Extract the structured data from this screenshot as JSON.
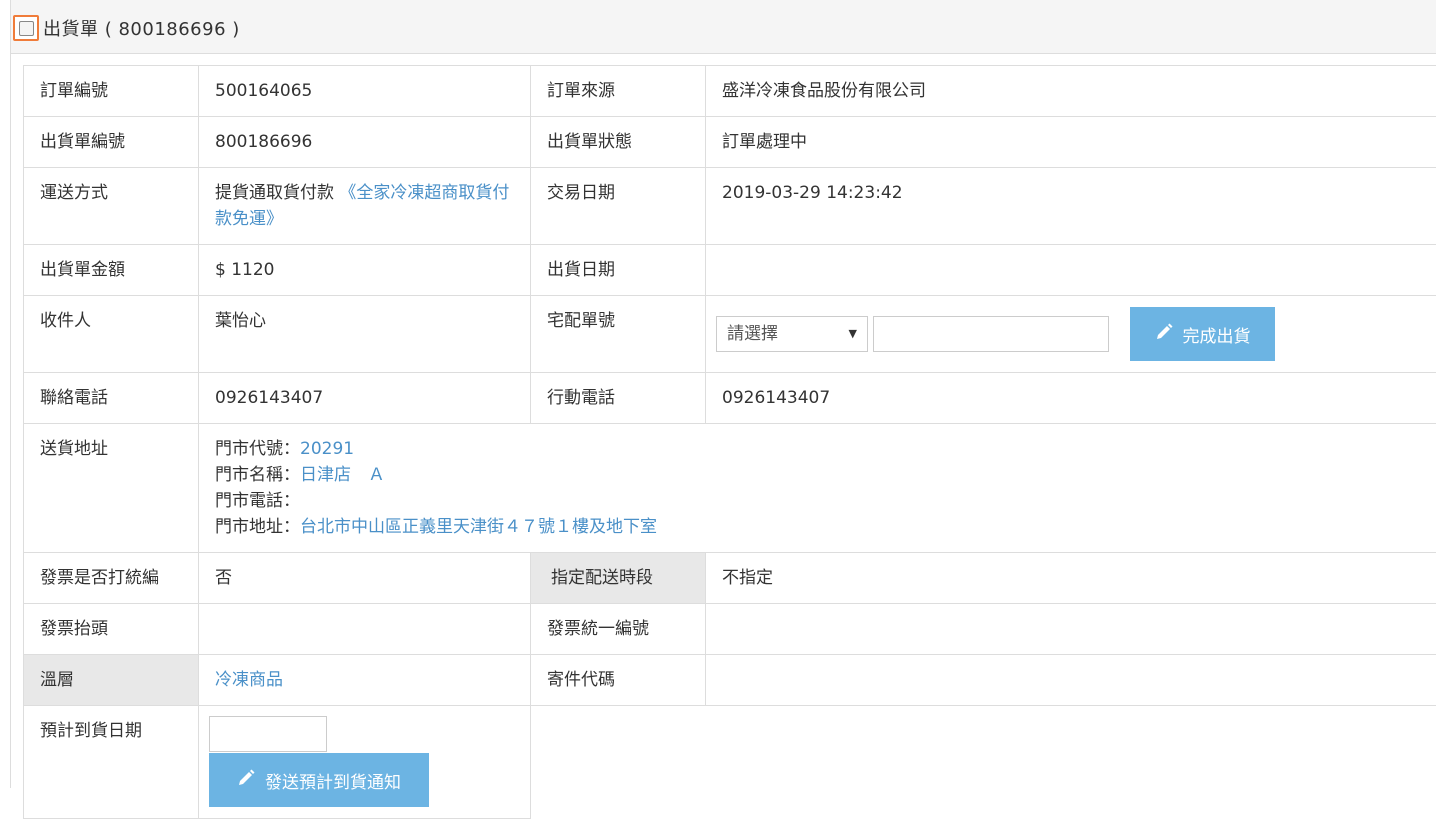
{
  "header": {
    "title": "出貨單 ( 800186696 )"
  },
  "rows": {
    "order_no_label": "訂單編號",
    "order_no": "500164065",
    "order_source_label": "訂單來源",
    "order_source": "盛洋冷凍食品股份有限公司",
    "ship_no_label": "出貨單編號",
    "ship_no": "800186696",
    "ship_status_label": "出貨單狀態",
    "ship_status": "訂單處理中",
    "delivery_label": "運送方式",
    "delivery_prefix": "提貨通取貨付款",
    "delivery_link": "《全家冷凍超商取貨付款免運》",
    "trade_date_label": "交易日期",
    "trade_date": "2019-03-29 14:23:42",
    "amount_label": "出貨單金額",
    "amount": "$ 1120",
    "ship_date_label": "出貨日期",
    "ship_date": "",
    "recipient_label": "收件人",
    "recipient": "葉怡心",
    "tracking_label": "宅配單號",
    "tracking_select": "請選擇",
    "complete_button": "完成出貨",
    "phone_label": "聯絡電話",
    "phone": "0926143407",
    "mobile_label": "行動電話",
    "mobile": "0926143407",
    "address_label": "送貨地址",
    "store_code_label": "門市代號：",
    "store_code": "20291",
    "store_name_label": "門市名稱：",
    "store_name": "日津店　Ａ",
    "store_phone_label": "門市電話：",
    "store_phone": "",
    "store_addr_label": "門市地址：",
    "store_addr": "台北市中山區正義里天津街４７號１樓及地下室",
    "invoice_tax_label": "發票是否打統編",
    "invoice_tax": "否",
    "time_slot_label": "指定配送時段",
    "time_slot": "不指定",
    "invoice_title_label": "發票抬頭",
    "invoice_title": "",
    "invoice_no_label": "發票統一編號",
    "invoice_no": "",
    "temp_label": "溫層",
    "temp": "冷凍商品",
    "sender_code_label": "寄件代碼",
    "sender_code": "",
    "eta_label": "預計到貨日期",
    "eta_button": "發送預計到貨通知"
  }
}
